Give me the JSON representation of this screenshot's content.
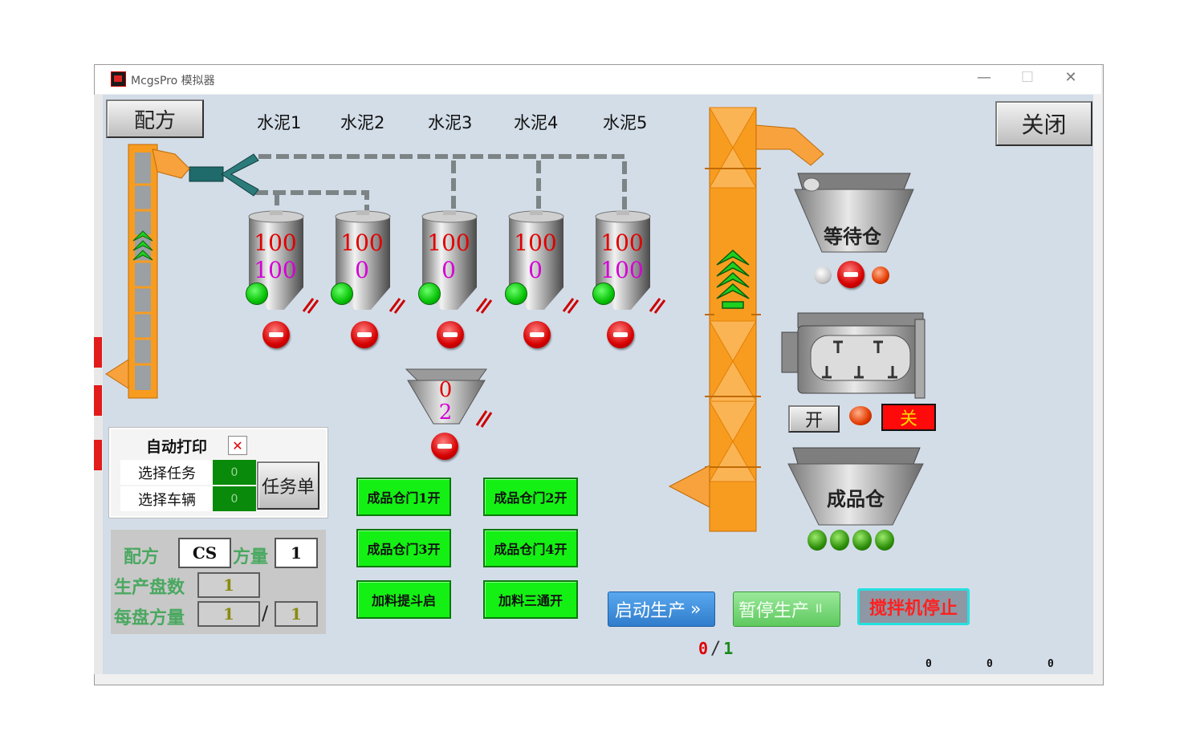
{
  "window": {
    "title": "McgsPro 模拟器",
    "minimize": "—",
    "maximize": "☐",
    "close": "✕"
  },
  "toolbar": {
    "recipe_button": "配方",
    "close_button": "关闭"
  },
  "silos": [
    {
      "label": "水泥1",
      "value_top": "100",
      "value_bottom": "100"
    },
    {
      "label": "水泥2",
      "value_top": "100",
      "value_bottom": "0"
    },
    {
      "label": "水泥3",
      "value_top": "100",
      "value_bottom": "0"
    },
    {
      "label": "水泥4",
      "value_top": "100",
      "value_bottom": "0"
    },
    {
      "label": "水泥5",
      "value_top": "100",
      "value_bottom": "100"
    }
  ],
  "scale_hopper": {
    "value_top": "0",
    "value_bottom": "2"
  },
  "waiting_bin": {
    "label": "等待仓"
  },
  "mixer": {
    "open_button": "开",
    "close_button": "关"
  },
  "product_bin": {
    "label": "成品仓"
  },
  "print_panel": {
    "title": "自动打印",
    "select_task_label": "选择任务",
    "select_task_value": "0",
    "select_vehicle_label": "选择车辆",
    "select_vehicle_value": "0",
    "task_button": "任务单"
  },
  "recipe_panel": {
    "recipe_label": "配方",
    "recipe_value": "CS",
    "volume_label": "方量",
    "volume_value": "1",
    "batch_count_label": "生产盘数",
    "batch_count_value": "1",
    "per_batch_label": "每盘方量",
    "per_batch_value": "1",
    "per_batch_divider": "/",
    "per_batch_total": "1"
  },
  "gate_buttons": [
    "成品仓门1开",
    "成品仓门2开",
    "成品仓门3开",
    "成品仓门4开",
    "加料提斗启",
    "加料三通开"
  ],
  "control": {
    "start_button": "启动生产",
    "start_glyph": "»",
    "pause_button": "暂停生产",
    "pause_glyph": "II",
    "mixer_stop_button": "搅拌机停止",
    "progress_current": "0",
    "progress_divider": "/",
    "progress_total": "1"
  },
  "counters": [
    "0",
    "0",
    "0"
  ],
  "colors": {
    "stage_bg": "#d3dde8",
    "conveyor": "#f89c20",
    "green_button": "#14f014",
    "start_blue": "#3f8fdc",
    "pause_green": "#7fdc7f",
    "stop_red": "#d60000",
    "value_red": "#e00000",
    "value_magenta": "#d500d5"
  }
}
